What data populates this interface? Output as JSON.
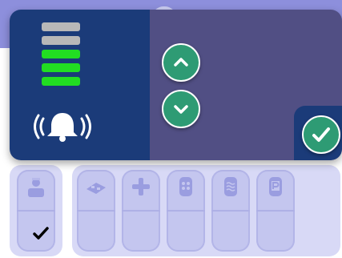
{
  "colors": {
    "modal_left_bg": "#1b3b79",
    "modal_right_bg": "#514f84",
    "level_active": "#22dd22",
    "level_inactive": "#b8b8b8",
    "button_green": "#2e9b74",
    "background_faded": "#d8d9f6"
  },
  "volume": {
    "active_levels": 3,
    "total_levels": 5
  },
  "icons": {
    "alarm": "alarm-bell-icon",
    "increase": "chevron-up-icon",
    "decrease": "chevron-down-icon",
    "confirm": "check-icon"
  },
  "background_tiles": {
    "side": [
      {
        "icon": "nurse-icon",
        "checked": true
      }
    ],
    "main": [
      {
        "icon": "tray-icon"
      },
      {
        "icon": "plus-icon"
      },
      {
        "icon": "remote-icon"
      },
      {
        "icon": "water-icon"
      },
      {
        "icon": "parking-icon"
      }
    ]
  }
}
